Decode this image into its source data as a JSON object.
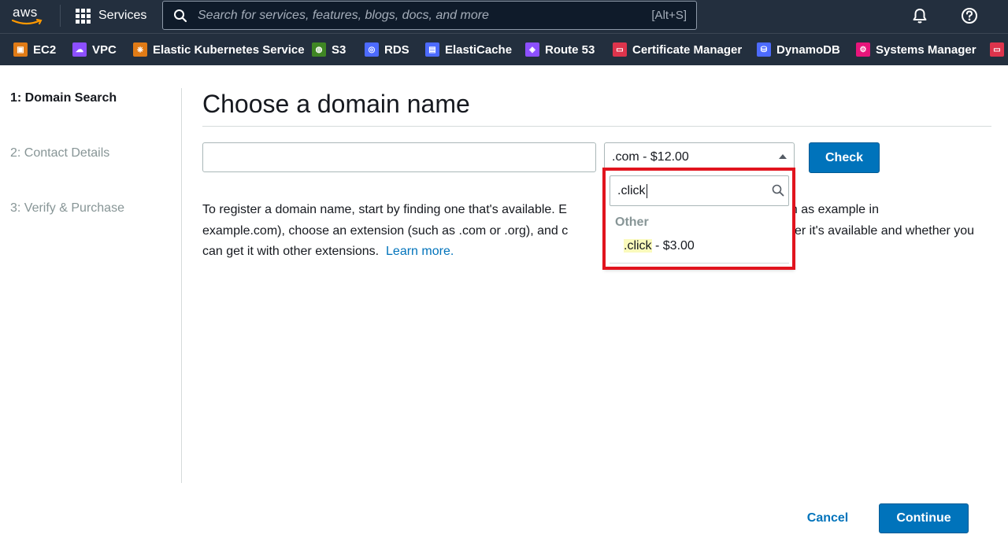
{
  "topnav": {
    "logo_text": "aws",
    "services_label": "Services",
    "search_placeholder": "Search for services, features, blogs, docs, and more",
    "search_shortcut": "[Alt+S]"
  },
  "favorites": [
    {
      "label": "EC2",
      "icon": "ec2-icon",
      "color": "#e07b16"
    },
    {
      "label": "VPC",
      "icon": "vpc-icon",
      "color": "#8c4fff"
    },
    {
      "label": "Elastic Kubernetes Service",
      "icon": "eks-icon",
      "color": "#e07b16"
    },
    {
      "label": "S3",
      "icon": "s3-icon",
      "color": "#3f8624"
    },
    {
      "label": "RDS",
      "icon": "rds-icon",
      "color": "#4d6bfe"
    },
    {
      "label": "ElastiCache",
      "icon": "elasticache-icon",
      "color": "#4d6bfe"
    },
    {
      "label": "Route 53",
      "icon": "route53-icon",
      "color": "#8c4fff"
    },
    {
      "label": "Certificate Manager",
      "icon": "certificate-manager-icon",
      "color": "#dd344c"
    },
    {
      "label": "DynamoDB",
      "icon": "dynamodb-icon",
      "color": "#4d6bfe"
    },
    {
      "label": "Systems Manager",
      "icon": "systems-manager-icon",
      "color": "#e7157b"
    }
  ],
  "wizard": {
    "steps": [
      {
        "label": "1: Domain Search",
        "state": "active"
      },
      {
        "label": "2: Contact Details",
        "state": "inactive"
      },
      {
        "label": "3: Verify & Purchase",
        "state": "inactive"
      }
    ]
  },
  "main": {
    "title": "Choose a domain name",
    "domain_input_value": "",
    "tld_selected": ".com - $12.00",
    "check_label": "Check",
    "description": "To register a domain name, start by finding one that's available. Enter the name (such as example in example.com), choose an extension (such as .com or .org), and click Check to find out whether it's available and whether you can get it with other extensions.",
    "visible_description_lines": [
      "To register a domain name, start by finding one that's available. E",
      "uch as example in",
      "example.com), choose an extension (such as .com or .org), and c",
      "er it's available and whether you",
      "can get it with other extensions."
    ],
    "learn_more": "Learn more."
  },
  "dropdown": {
    "query": ".click",
    "group_label": "Other",
    "option_highlight": ".click",
    "option_rest": " - $3.00"
  },
  "footer": {
    "cancel_label": "Cancel",
    "continue_label": "Continue"
  },
  "colors": {
    "nav_bg": "#232f3e",
    "primary": "#0073bb",
    "highlight_frame": "#e1141e"
  }
}
